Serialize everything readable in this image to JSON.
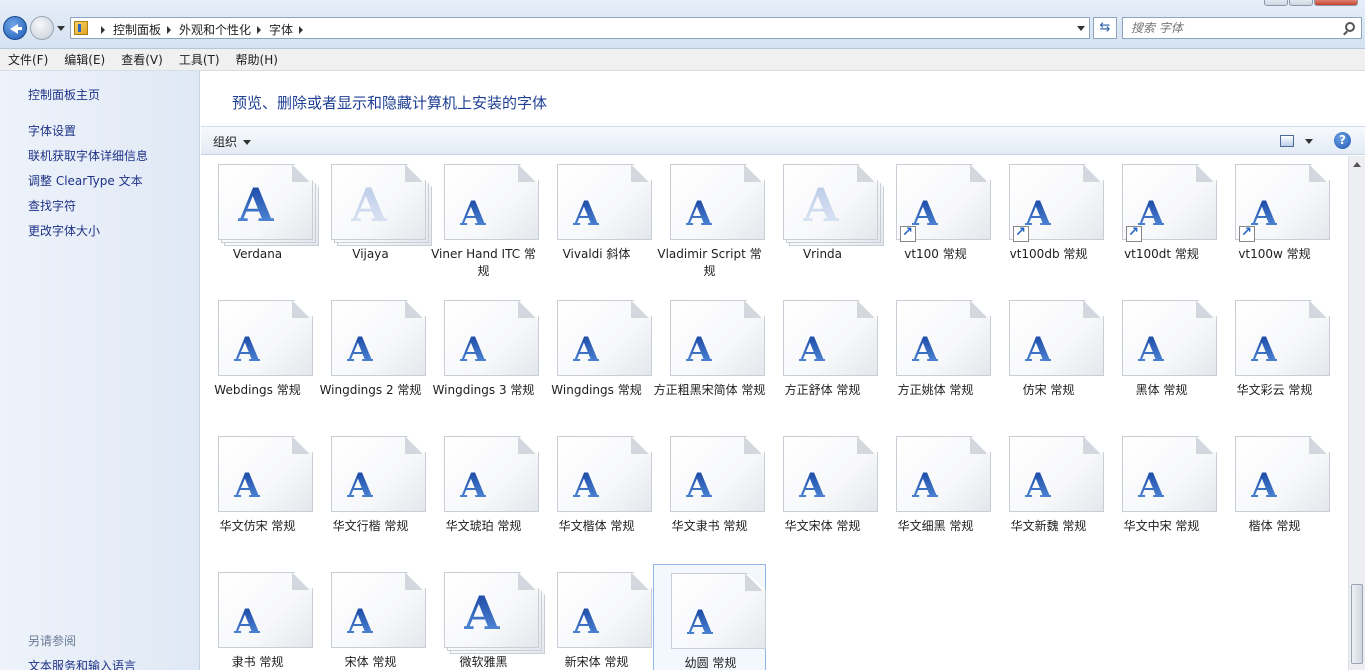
{
  "address": {
    "crumbs": [
      "控制面板",
      "外观和个性化",
      "字体"
    ],
    "search_placeholder": "搜索 字体"
  },
  "menu": [
    "文件(F)",
    "编辑(E)",
    "查看(V)",
    "工具(T)",
    "帮助(H)"
  ],
  "sidebar": {
    "links": [
      "控制面板主页",
      "字体设置",
      "联机获取字体详细信息",
      "调整 ClearType 文本",
      "查找字符",
      "更改字体大小"
    ],
    "see_also_header": "另请参阅",
    "see_also_links": [
      "文本服务和输入语言"
    ]
  },
  "main": {
    "title": "预览、删除或者显示和隐藏计算机上安装的字体",
    "organize_label": "组织",
    "help_glyph": "?",
    "glyph_letter": "A"
  },
  "fonts": [
    {
      "name": "Verdana",
      "stack": true
    },
    {
      "name": "Vijaya",
      "stack": true,
      "faded": true
    },
    {
      "name": "Viner Hand ITC 常规"
    },
    {
      "name": "Vivaldi 斜体"
    },
    {
      "name": "Vladimir Script 常规"
    },
    {
      "name": "Vrinda",
      "stack": true,
      "faded": true
    },
    {
      "name": "vt100 常规",
      "shortcut": true
    },
    {
      "name": "vt100db 常规",
      "shortcut": true
    },
    {
      "name": "vt100dt 常规",
      "shortcut": true
    },
    {
      "name": "vt100w 常规",
      "shortcut": true
    },
    {
      "name": "Webdings 常规"
    },
    {
      "name": "Wingdings 2 常规"
    },
    {
      "name": "Wingdings 3 常规"
    },
    {
      "name": "Wingdings 常规"
    },
    {
      "name": "方正粗黑宋简体 常规"
    },
    {
      "name": "方正舒体 常规"
    },
    {
      "name": "方正姚体 常规"
    },
    {
      "name": "仿宋 常规"
    },
    {
      "name": "黑体 常规"
    },
    {
      "name": "华文彩云 常规"
    },
    {
      "name": "华文仿宋 常规"
    },
    {
      "name": "华文行楷 常规"
    },
    {
      "name": "华文琥珀 常规"
    },
    {
      "name": "华文楷体 常规"
    },
    {
      "name": "华文隶书 常规"
    },
    {
      "name": "华文宋体 常规"
    },
    {
      "name": "华文细黑 常规"
    },
    {
      "name": "华文新魏 常规"
    },
    {
      "name": "华文中宋 常规"
    },
    {
      "name": "楷体 常规"
    },
    {
      "name": "隶书 常规"
    },
    {
      "name": "宋体 常规"
    },
    {
      "name": "微软雅黑",
      "stack": true
    },
    {
      "name": "新宋体 常规"
    },
    {
      "name": "幼圆 常规",
      "selected": true
    }
  ]
}
